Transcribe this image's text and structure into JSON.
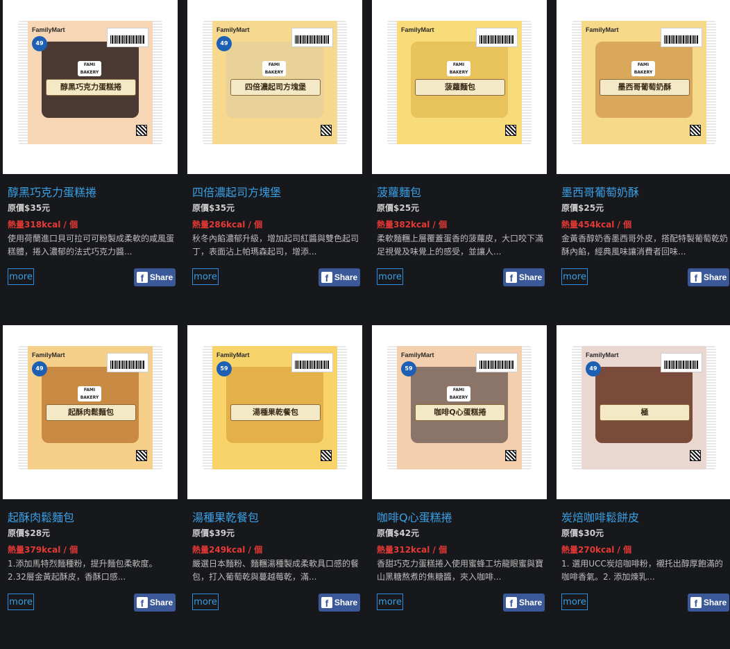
{
  "products": [
    {
      "name": "醇黑巧克力蛋糕捲",
      "price": "原價$35元",
      "kcal": "熱量318kcal / 個",
      "desc": "使用荷蘭進口貝可拉可可粉製成柔軟的咸風蛋糕體，捲入濃郁的法式巧克力醬...",
      "pkg_brand": "FamilyMart",
      "pkg_label": "醇黑巧克力蛋糕捲",
      "pkg_badge": "49",
      "pkg_fami": "FAMI BAKERY",
      "colors": {
        "bag": "#f7d6b6",
        "food": "#4a3a33"
      }
    },
    {
      "name": "四倍濃起司方塊堡",
      "price": "原價$35元",
      "kcal": "熱量286kcal / 個",
      "desc": "秋冬內餡濃郁升級，增加起司紅醬與雙色起司丁，表面沾上帕瑪森起司，增添...",
      "pkg_brand": "FamilyMart",
      "pkg_label": "四倍濃起司方塊堡",
      "pkg_badge": "49",
      "pkg_fami": "FAMI BAKERY",
      "colors": {
        "bag": "#f6d98e",
        "food": "#e8d29a"
      }
    },
    {
      "name": "菠蘿麵包",
      "price": "原價$25元",
      "kcal": "熱量382kcal / 個",
      "desc": "柔軟麵糰上層覆蓋蛋香的菠蘿皮，大口咬下滿足視覺及味覺上的感受，並讓人...",
      "pkg_brand": "FamilyMart",
      "pkg_label": "菠蘿麵包",
      "pkg_badge": "",
      "pkg_fami": "FAMI BAKERY",
      "colors": {
        "bag": "#f8dc7a",
        "food": "#e8c25a"
      }
    },
    {
      "name": "墨西哥葡萄奶酥",
      "price": "原價$25元",
      "kcal": "熱量454kcal / 個",
      "desc": "金黃香醇奶香墨西哥外皮，搭配特製葡萄乾奶酥內餡，經典風味讓消費者回味...",
      "pkg_brand": "FamilyMart",
      "pkg_label": "墨西哥葡萄奶酥",
      "pkg_badge": "",
      "pkg_fami": "FAMI BAKERY",
      "colors": {
        "bag": "#f7d98a",
        "food": "#d9a85a"
      }
    },
    {
      "name": "起酥肉鬆麵包",
      "price": "原價$28元",
      "kcal": "熱量379kcal / 個",
      "desc": "1.添加馬特烈麵種粉，提升麵包柔軟度。2.32層金黃起酥皮，香酥口感...",
      "pkg_brand": "FamilyMart",
      "pkg_label": "起酥肉鬆麵包",
      "pkg_badge": "49",
      "pkg_fami": "FAMI BAKERY",
      "colors": {
        "bag": "#f6d08a",
        "food": "#c98a44"
      }
    },
    {
      "name": "湯種果乾餐包",
      "price": "原價$39元",
      "kcal": "熱量249kcal / 個",
      "desc": "嚴選日本麵粉、麵糰湯種製成柔軟具口感的餐包，打入葡萄乾與蔓越莓乾，滿...",
      "pkg_brand": "FamilyMart",
      "pkg_label": "湯種果乾餐包",
      "pkg_badge": "59",
      "pkg_fami": "",
      "colors": {
        "bag": "#f8d36a",
        "food": "#e3b04a"
      }
    },
    {
      "name": "咖啡Q心蛋糕捲",
      "price": "原價$42元",
      "kcal": "熱量312kcal / 個",
      "desc": "香甜巧克力蛋糕捲入使用蜜蜂工坊龍眼蜜與寶山黑糖熬煮的焦糖醬，夾入咖啡...",
      "pkg_brand": "FamilyMart",
      "pkg_label": "咖啡Q心蛋糕捲",
      "pkg_badge": "59",
      "pkg_fami": "FAMI BAKERY",
      "colors": {
        "bag": "#f3cfae",
        "food": "#8a7568"
      }
    },
    {
      "name": "炭焙咖啡鬆餅皮",
      "price": "原價$30元",
      "kcal": "熱量270kcal / 個",
      "desc": "1. 選用UCC炭焙咖啡粉，襯托出醇厚飽滿的咖啡香氣。2. 添加煉乳...",
      "pkg_brand": "FamilyMart",
      "pkg_label": "極",
      "pkg_badge": "49",
      "pkg_fami": "",
      "colors": {
        "bag": "#ead7cf",
        "food": "#7a4a3a"
      }
    }
  ],
  "ui": {
    "more_label": "more",
    "share_label": "Share",
    "fb_glyph": "f"
  }
}
